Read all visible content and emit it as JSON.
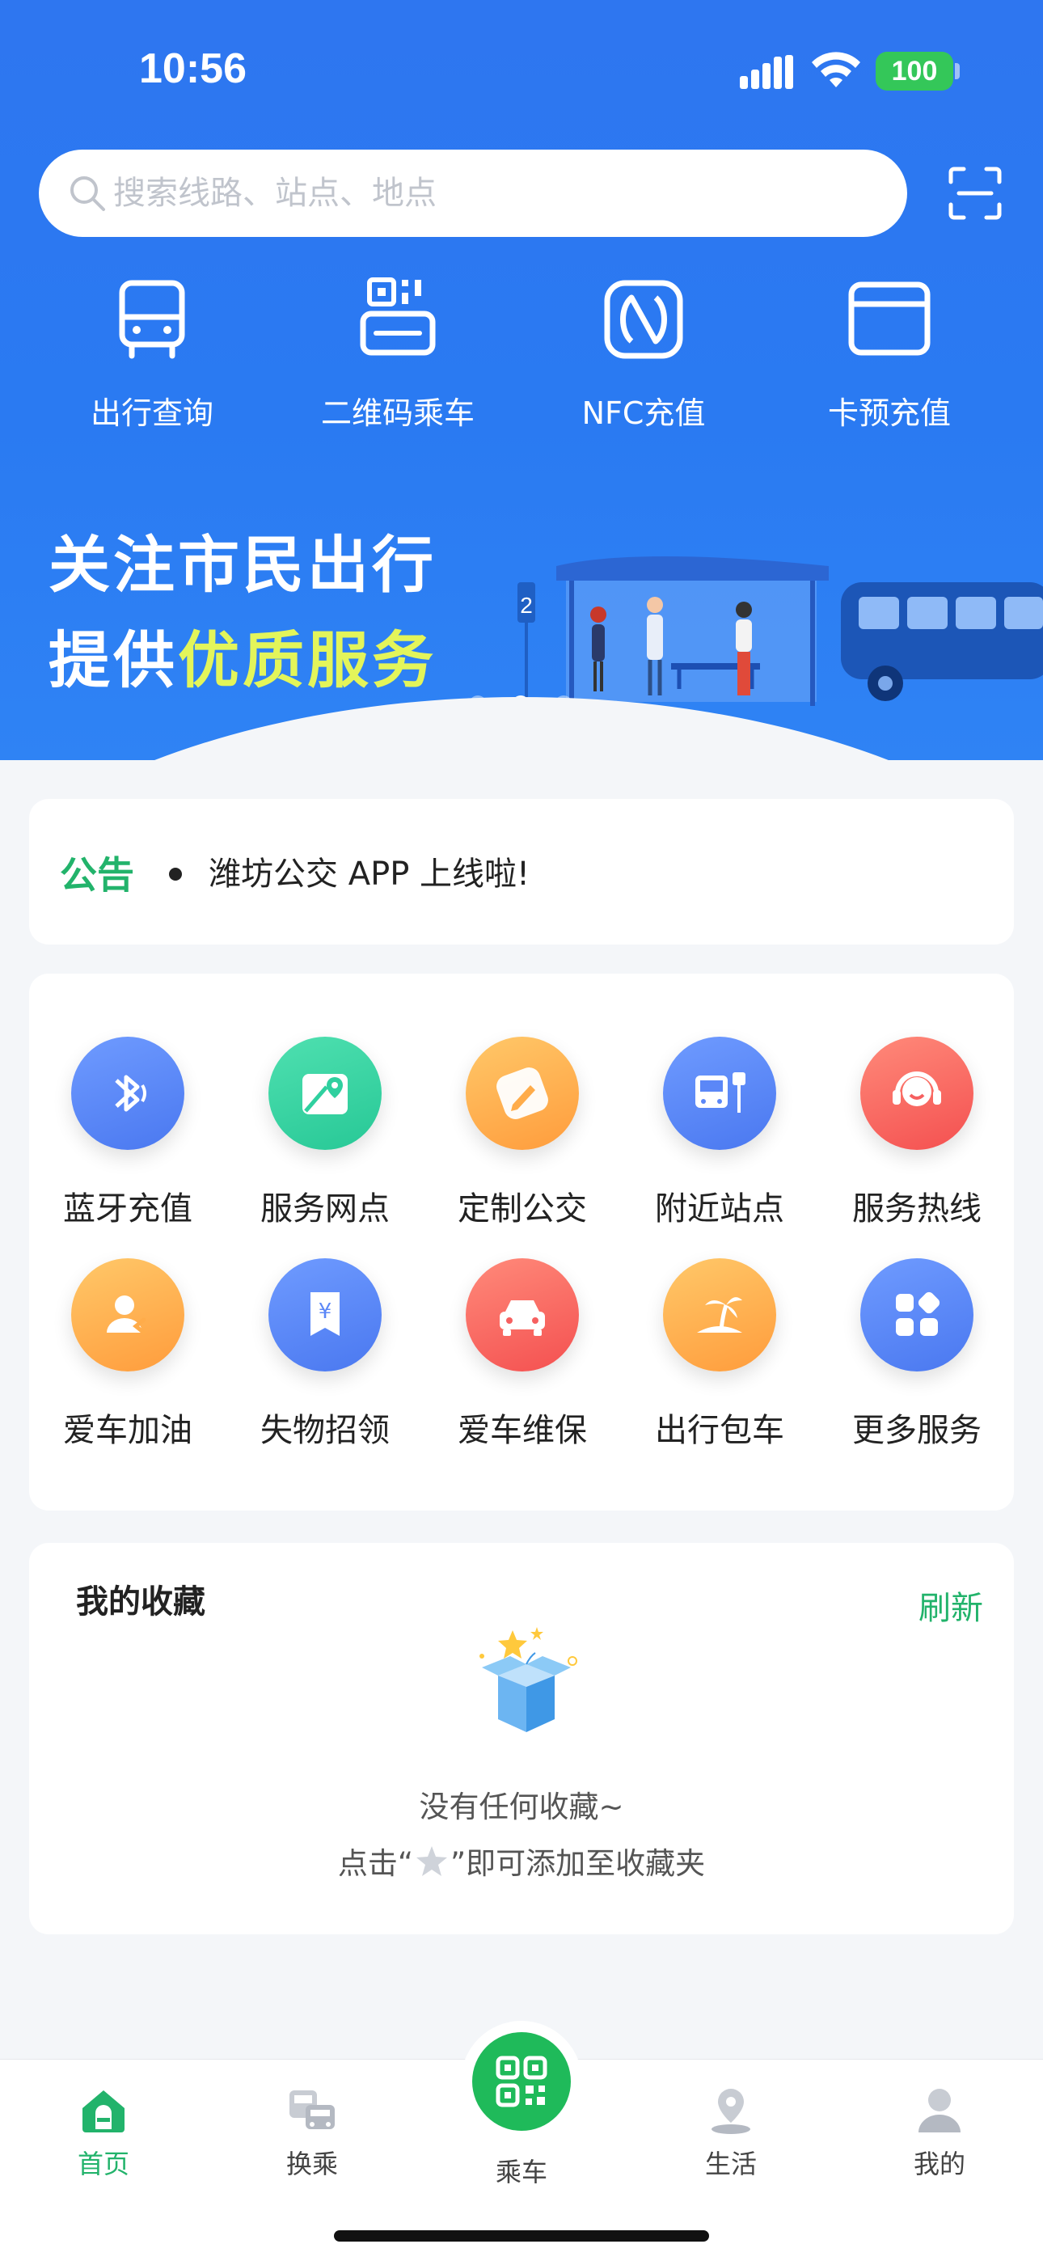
{
  "status_bar": {
    "time": "10:56",
    "battery": "100"
  },
  "search": {
    "placeholder": "搜索线路、站点、地点"
  },
  "quick_actions": [
    {
      "label": "出行查询",
      "icon": "bus-icon"
    },
    {
      "label": "二维码乘车",
      "icon": "qr-ride-icon"
    },
    {
      "label": "NFC充值",
      "icon": "nfc-icon"
    },
    {
      "label": "卡预充值",
      "icon": "card-icon"
    }
  ],
  "banner": {
    "line1": "关注市民出行",
    "line2_prefix": "提供",
    "line2_highlight": "优质服务",
    "stop_number": "2",
    "active_dot": 2,
    "dot_count": 3
  },
  "notice": {
    "tag": "公告",
    "text": "潍坊公交 APP 上线啦!"
  },
  "services": [
    {
      "label": "蓝牙充值",
      "icon": "bluetooth-icon",
      "color": "#5b87f7"
    },
    {
      "label": "服务网点",
      "icon": "map-pin-icon",
      "color": "#2fd09f"
    },
    {
      "label": "定制公交",
      "icon": "pencil-icon",
      "color": "#ffac4a"
    },
    {
      "label": "附近站点",
      "icon": "bus-stop-icon",
      "color": "#5b87f7"
    },
    {
      "label": "服务热线",
      "icon": "headset-icon",
      "color": "#f66060"
    },
    {
      "label": "爱车加油",
      "icon": "fuel-user-icon",
      "color": "#ffac4a"
    },
    {
      "label": "失物招领",
      "icon": "lost-found-icon",
      "color": "#5b87f7"
    },
    {
      "label": "爱车维保",
      "icon": "car-icon",
      "color": "#f66060"
    },
    {
      "label": "出行包车",
      "icon": "palm-island-icon",
      "color": "#ffac4a"
    },
    {
      "label": "更多服务",
      "icon": "grid-icon",
      "color": "#5b87f7"
    }
  ],
  "favorites": {
    "title": "我的收藏",
    "refresh": "刷新",
    "empty_line1": "没有任何收藏~",
    "empty_line2_pre": "点击“",
    "empty_line2_post": "”即可添加至收藏夹"
  },
  "tabbar": {
    "home": "首页",
    "transfer": "换乘",
    "ride": "乘车",
    "life": "生活",
    "mine": "我的"
  },
  "colors": {
    "primary_blue": "#2e76f0",
    "accent_green": "#22b36b",
    "highlight_yellow": "#e3f55a"
  }
}
